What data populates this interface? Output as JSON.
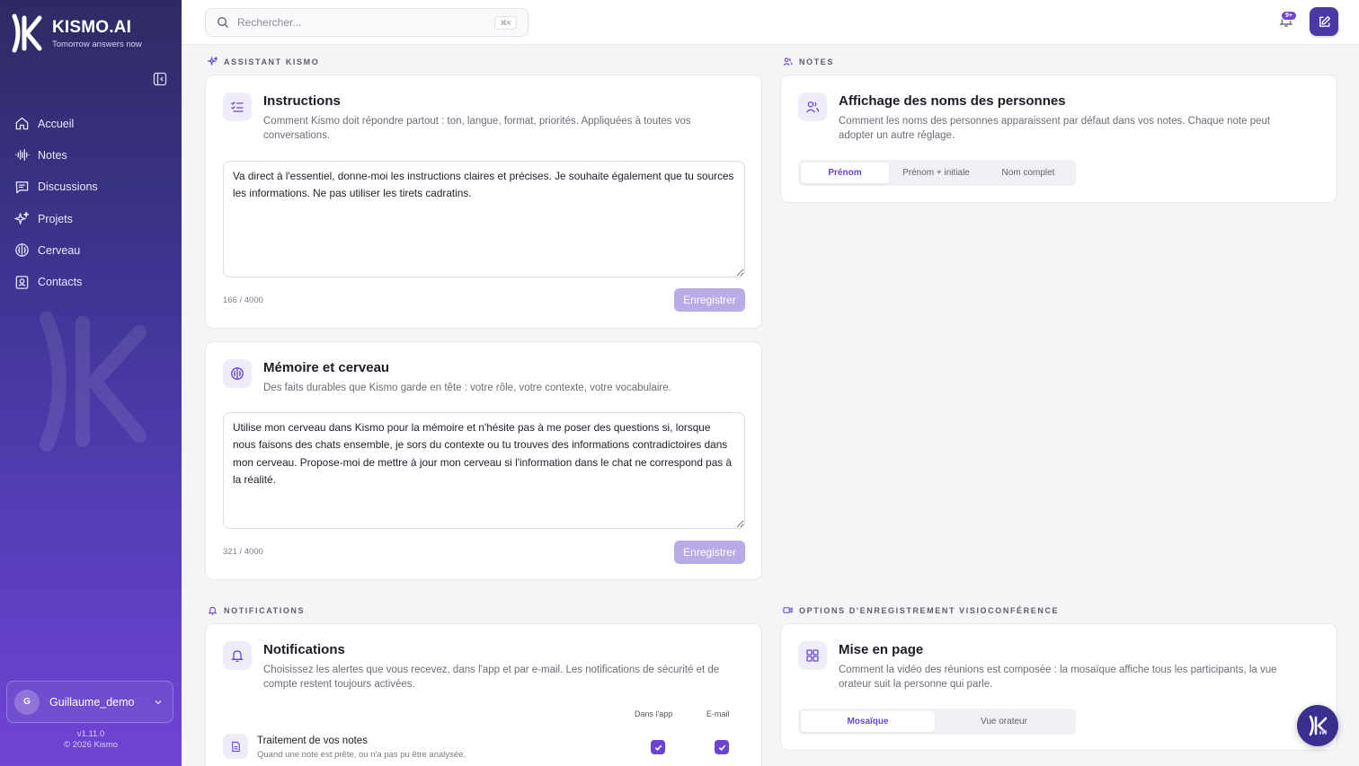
{
  "brand": {
    "name": "KISMO.AI",
    "tagline": "Tomorrow answers now"
  },
  "sidebar": {
    "items": [
      {
        "label": "Accueil",
        "icon": "home-icon"
      },
      {
        "label": "Notes",
        "icon": "waveform-icon"
      },
      {
        "label": "Discussions",
        "icon": "chat-icon"
      },
      {
        "label": "Projets",
        "icon": "sparkles-icon"
      },
      {
        "label": "Cerveau",
        "icon": "brain-icon"
      },
      {
        "label": "Contacts",
        "icon": "contact-card-icon"
      }
    ],
    "user": {
      "initial": "G",
      "name": "Guillaume_demo"
    },
    "version": "v1.11.0",
    "copyright": "© 2026 Kismo"
  },
  "topbar": {
    "search_placeholder": "Rechercher...",
    "shortcut": "⌘K",
    "notif_badge": "9+"
  },
  "sections": {
    "assistant": "ASSISTANT KISMO",
    "notes": "NOTES",
    "notifications": "NOTIFICATIONS",
    "recording": "OPTIONS D'ENREGISTREMENT VISIOCONFÉRENCE"
  },
  "instructions": {
    "title": "Instructions",
    "desc": "Comment Kismo doit répondre partout : ton, langue, format, priorités. Appliquées à toutes vos conversations.",
    "value": "Va direct à l'essentiel, donne-moi les instructions claires et précises. Je souhaite également que tu sources les informations. Ne pas utiliser les tirets cadratins.",
    "counter": "166 / 4000",
    "save_label": "Enregistrer"
  },
  "memory": {
    "title": "Mémoire et cerveau",
    "desc": "Des faits durables que Kismo garde en tête : votre rôle, votre contexte, votre vocabulaire.",
    "value": "Utilise mon cerveau dans Kismo pour la mémoire et n'hésite pas à me poser des questions si, lorsque nous faisons des chats ensemble, je sors du contexte ou tu trouves des informations contradictoires dans mon cerveau. Propose-moi de mettre à jour mon cerveau si l'information dans le chat ne correspond pas à la réalité.",
    "counter": "321 / 4000",
    "save_label": "Enregistrer"
  },
  "names_display": {
    "title": "Affichage des noms des personnes",
    "desc": "Comment les noms des personnes apparaissent par défaut dans vos notes. Chaque note peut adopter un autre réglage.",
    "options": [
      "Prénom",
      "Prénom + initiale",
      "Nom complet"
    ],
    "selected": "Prénom"
  },
  "notifications": {
    "title": "Notifications",
    "desc": "Choisissez les alertes que vous recevez, dans l'app et par e-mail. Les notifications de sécurité et de compte restent toujours activées.",
    "col_app": "Dans l'app",
    "col_email": "E-mail",
    "row_title": "Traitement de vos notes",
    "row_sub": "Quand une note est prête, ou n'a pas pu être analysée."
  },
  "layout_option": {
    "title": "Mise en page",
    "desc": "Comment la vidéo des réunions est composée : la mosaïque affiche tous les participants, la vue orateur suit la personne qui parle.",
    "options": [
      "Mosaïque",
      "Vue orateur"
    ],
    "selected": "Mosaïque"
  },
  "colors": {
    "accent": "#6a44d4",
    "sidebar_top": "#2e2b63",
    "sidebar_bottom": "#7044d4"
  }
}
